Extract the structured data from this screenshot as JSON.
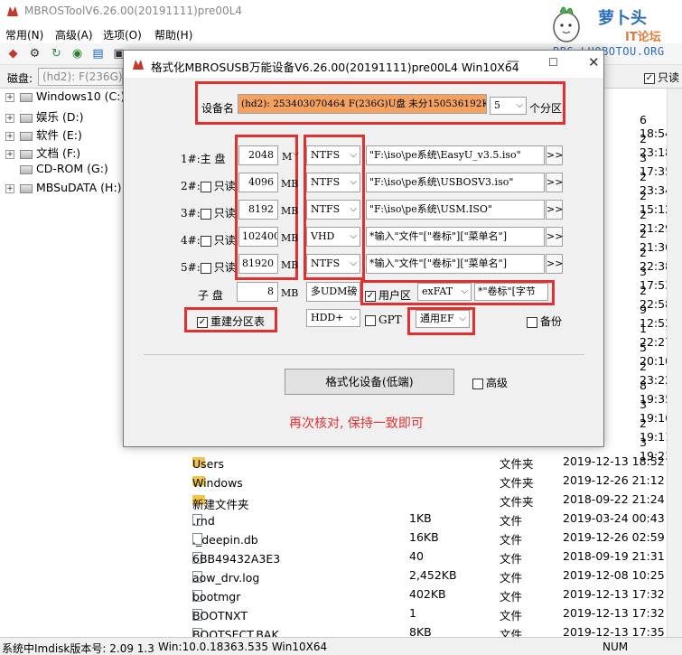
{
  "app": {
    "title": "MBROSToolV6.26.00(20191111)pre00L4"
  },
  "menu": [
    "常用(N)",
    "高级(A)",
    "选项(O)",
    "帮助(H)"
  ],
  "diskbar": {
    "label": "磁盘:",
    "value": "(hd2): F(236G)U",
    "checkbox_label": "只读"
  },
  "tree": [
    {
      "label": "Windows10 (C:)"
    },
    {
      "label": "娱乐 (D:)"
    },
    {
      "label": "软件 (E:)"
    },
    {
      "label": "文档 (F:)"
    },
    {
      "label": "CD-ROM (G:)"
    },
    {
      "label": "MBSuDATA (H:)"
    }
  ],
  "right_dates": [
    "6 18:54",
    "2 23:18",
    "3 17:35",
    "2 23:34",
    "2 15:12",
    "2 21:29",
    "2 21:30",
    "2 22:38",
    "3 17:53",
    "2 22:58",
    "9 12:52",
    "1 22:27",
    "5 20:10",
    "2 23:22",
    "8 19:35",
    "3 19:16",
    "2 19:11",
    "3 19:23"
  ],
  "files": [
    {
      "name": "Users",
      "size": "",
      "type": "文件夹",
      "date": "2019-12-13 18:52",
      "icon": "folder"
    },
    {
      "name": "Windows",
      "size": "",
      "type": "文件夹",
      "date": "2019-12-26 21:12",
      "icon": "folder"
    },
    {
      "name": "新建文件夹",
      "size": "",
      "type": "文件夹",
      "date": "2018-09-22 21:24",
      "icon": "folder"
    },
    {
      "name": ".rnd",
      "size": "1KB",
      "type": "文件",
      "date": "2019-03-24 00:43",
      "icon": "file"
    },
    {
      "name": "._deepin.db",
      "size": "16KB",
      "type": "文件",
      "date": "2019-12-26 02:59",
      "icon": "file"
    },
    {
      "name": "6BB49432A3E3",
      "size": "40",
      "type": "文件",
      "date": "2018-09-19 21:31",
      "icon": "file"
    },
    {
      "name": "aow_drv.log",
      "size": "2,452KB",
      "type": "文件",
      "date": "2019-12-08 10:25",
      "icon": "file"
    },
    {
      "name": "bootmgr",
      "size": "402KB",
      "type": "文件",
      "date": "2019-12-13 17:32",
      "icon": "file"
    },
    {
      "name": "BOOTNXT",
      "size": "1",
      "type": "文件",
      "date": "2019-12-13 17:32",
      "icon": "file"
    },
    {
      "name": "BOOTSECT.BAK",
      "size": "8KB",
      "type": "文件",
      "date": "2019-12-13 17:35",
      "icon": "file"
    }
  ],
  "status": {
    "left": "系统中Imdisk版本号: 2.09 1.3",
    "mid": "Win:10.0.18363.535 Win10X64",
    "num": "NUM"
  },
  "watermark": {
    "text1": "萝卜头",
    "text2": "IT论坛",
    "url": "BBS.LUOBOTOU.ORG"
  },
  "dialog": {
    "title": "格式化MBROSUSB万能设备V6.26.00(20191111)pre00L4 Win10X64",
    "device_label": "设备名",
    "device_value": "(hd2): 253403070464 F(236G)U盘 未分150536192K",
    "part_count": "5",
    "part_suffix": "个分区",
    "partitions": [
      {
        "label": "1#:主  盘",
        "readonly": "",
        "size": "2048",
        "unit": "M",
        "fs": "NTFS",
        "path": "\"F:\\iso\\pe系统\\EasyU_v3.5.iso\""
      },
      {
        "label": "2#:",
        "readonly": "只读",
        "size": "4096",
        "unit": "MB",
        "fs": "NTFS",
        "path": "\"F:\\iso\\pe系统\\USBOSV3.iso\""
      },
      {
        "label": "3#:",
        "readonly": "只读",
        "size": "8192",
        "unit": "MB",
        "fs": "NTFS",
        "path": "\"F:\\iso\\pe系统\\USM.ISO\""
      },
      {
        "label": "4#:",
        "readonly": "只读",
        "size": "102400",
        "unit": "MB",
        "fs": "VHD",
        "path": "*输入\"文件\"[\"卷标\"][\"菜单名\"]"
      },
      {
        "label": "5#:",
        "readonly": "只读",
        "size": "81920",
        "unit": "MB",
        "fs": "NTFS",
        "path": "*输入\"文件\"[\"卷标\"][\"菜单名\"]"
      }
    ],
    "sub_label": "子  盘",
    "sub_size": "8",
    "sub_unit": "MB",
    "sub_fs": "多UDM磅",
    "user_area_label": "用户区",
    "user_fs": "exFAT",
    "user_path": "*\"卷标\"[字节",
    "rebuild_label": "重建分区表",
    "hdd_value": "HDD+",
    "gpt_label": "GPT",
    "ef_value": "通用EF",
    "backup_label": "备份",
    "format_button": "格式化设备(低端)",
    "advanced_label": "高级",
    "note": "再次核对, 保持一致即可",
    "arrow": ">>"
  },
  "colors": {
    "highlight": "#e03030",
    "device_bg": "#f4a261",
    "folder": "#f4c542"
  }
}
